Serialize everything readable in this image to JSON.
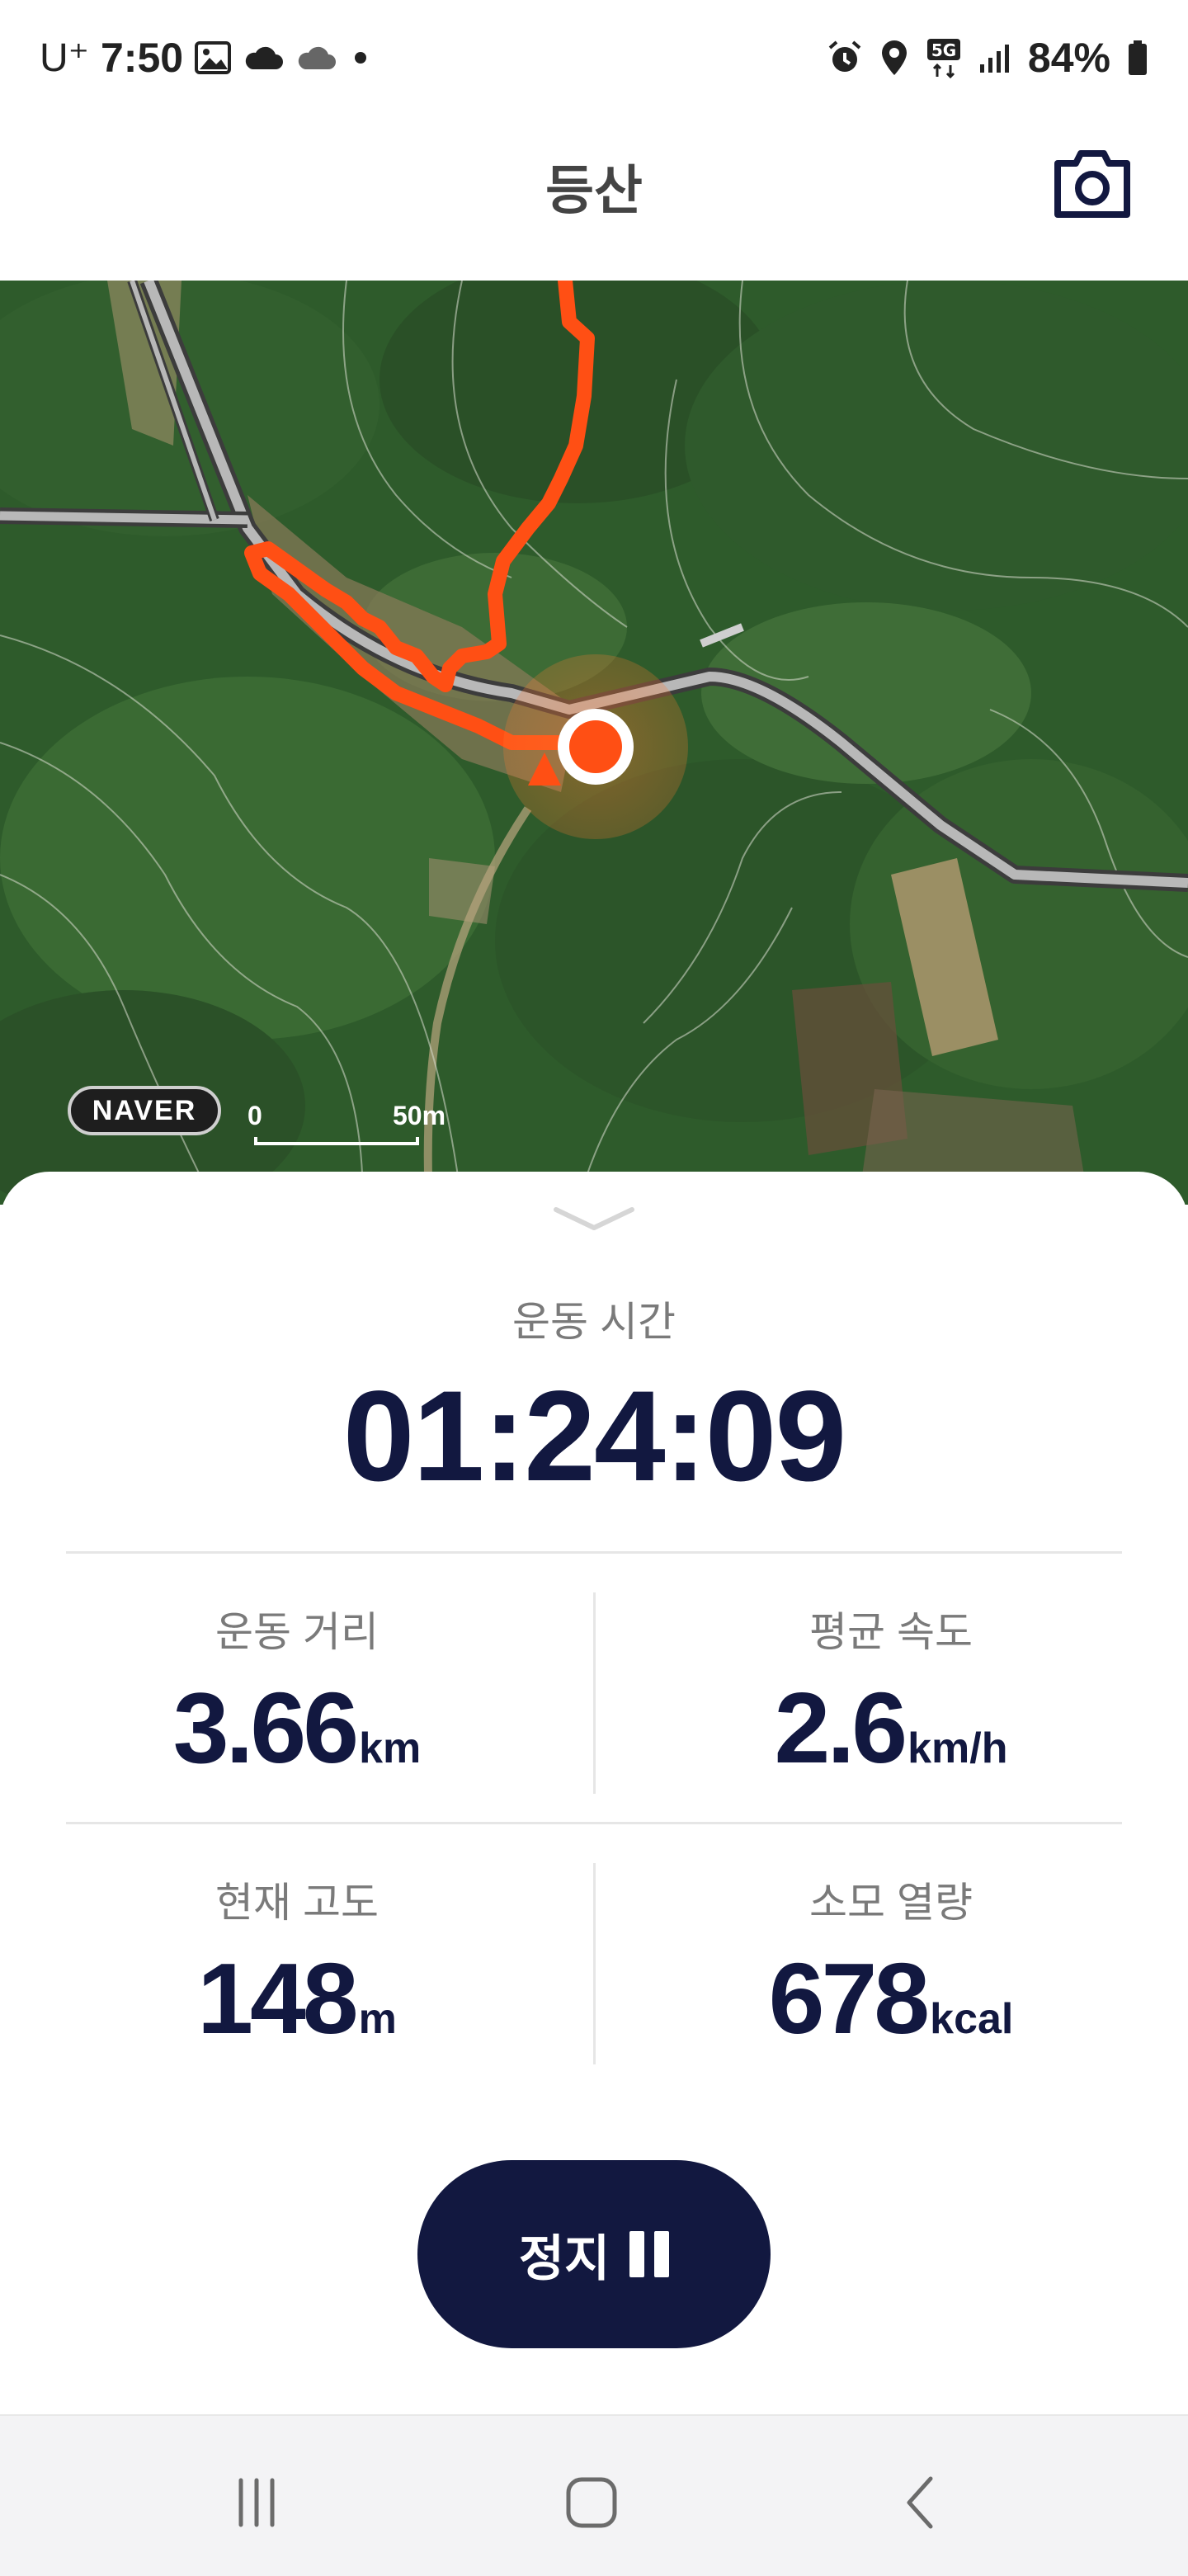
{
  "status_bar": {
    "carrier": "U⁺",
    "time": "7:50",
    "left_icons": [
      "gallery-icon",
      "cloud-icon",
      "cloud-icon",
      "dot-icon"
    ],
    "right_icons": [
      "alarm-icon",
      "location-icon",
      "5g-icon",
      "signal-icon"
    ],
    "network": "5G",
    "battery": "84%"
  },
  "header": {
    "title": "등산",
    "camera_icon": "camera-icon"
  },
  "map": {
    "provider_badge": "NAVER",
    "scale_start": "0",
    "scale_end": "50m",
    "colors": {
      "route": "#ff5a1f",
      "position": "#ff5a1f",
      "road": "#9a9a9a"
    }
  },
  "workout": {
    "time_label": "운동 시간",
    "time_value": "01:24:09",
    "stats": [
      {
        "label": "운동 거리",
        "value": "3.66",
        "unit": "km"
      },
      {
        "label": "평균 속도",
        "value": "2.6",
        "unit": "km/h"
      },
      {
        "label": "현재 고도",
        "value": "148",
        "unit": "m"
      },
      {
        "label": "소모 열량",
        "value": "678",
        "unit": "kcal"
      }
    ],
    "stop_label": "정지"
  },
  "colors": {
    "primary_navy": "#121840",
    "label_gray": "#7a7a7a"
  },
  "nav": {
    "recent_icon": "recent-apps-icon",
    "home_icon": "home-icon",
    "back_icon": "back-icon"
  }
}
